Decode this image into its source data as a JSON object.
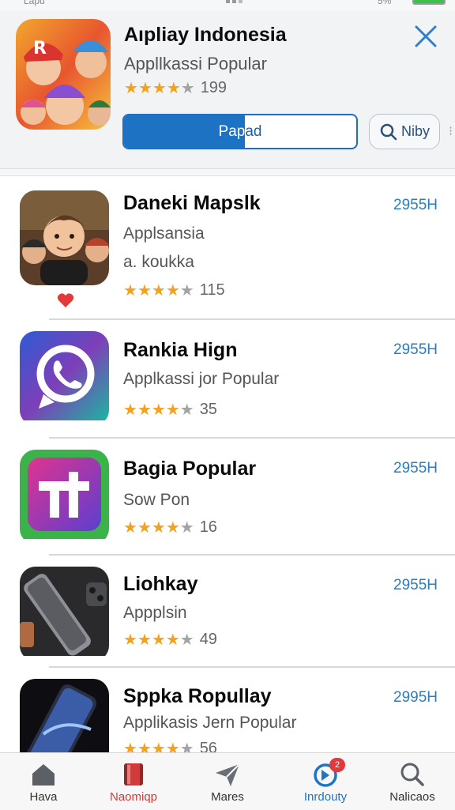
{
  "status_bar": {
    "carrier": "Lapu",
    "battery_pct": "5%"
  },
  "header": {
    "title": "Aıpliay Indonesia",
    "subtitle": "Appllkassi Popular",
    "rating": 4,
    "rating_count": "199",
    "primary_button": {
      "label": "Papad",
      "progress": 0.52
    },
    "search_button": {
      "label": "Niby"
    },
    "close_icon": "close-icon",
    "edge_glyph": "⁝"
  },
  "apps": [
    {
      "title": "Daneki Mapslk",
      "subtitle": "Applsansia",
      "subtitle2": "a. koukka",
      "rating": 4,
      "count": "115",
      "price": "2955H",
      "favorited": true
    },
    {
      "title": "Rankia Hign",
      "subtitle": "Applkassi јor Popular",
      "rating": 4,
      "count": "35",
      "price": "2955H"
    },
    {
      "title": "Bagia Popular",
      "subtitle": "Sow Pon",
      "rating": 4,
      "count": "16",
      "price": "2955H"
    },
    {
      "title": "Liohkay",
      "subtitle": "Appplsin",
      "rating": 4,
      "count": "49",
      "price": "2955H"
    },
    {
      "title": "Sppka Ropullay",
      "subtitle": "Applikasis Jern Popular",
      "rating": 4,
      "count": "56",
      "price": "2995H"
    }
  ],
  "tabs": [
    {
      "label": "Hava",
      "icon": "home-icon",
      "active": false
    },
    {
      "label": "Naomiqp",
      "icon": "bookmark-icon",
      "active": true,
      "color": "#d23b3b"
    },
    {
      "label": "Mares",
      "icon": "send-icon",
      "active": false
    },
    {
      "label": "Inrdouty",
      "icon": "update-icon",
      "active": true,
      "color": "#1f74c6",
      "badge": "2"
    },
    {
      "label": "Nalicaos",
      "icon": "search-icon",
      "active": false
    }
  ],
  "colors": {
    "accent": "#1d72c4",
    "star": "#f3a21d",
    "price": "#2a7ec0",
    "heart": "#e23a3a"
  }
}
